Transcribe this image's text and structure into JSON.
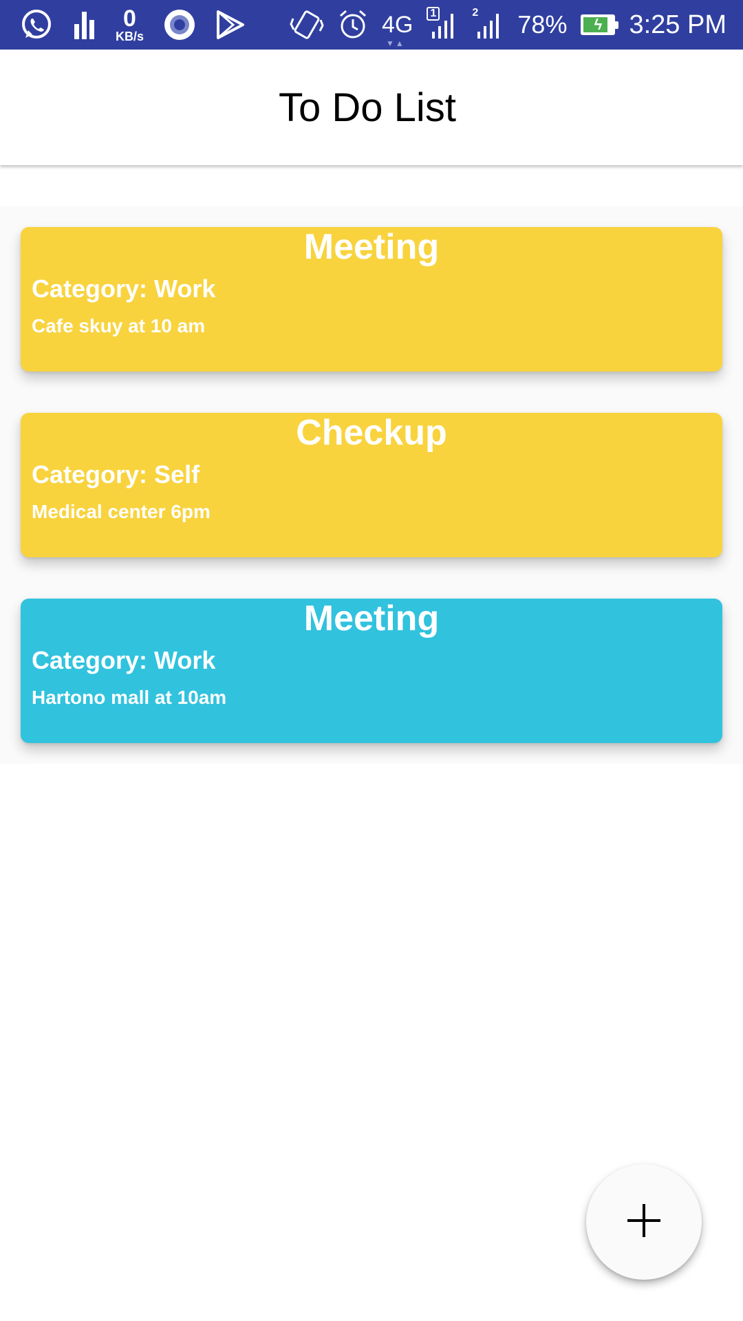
{
  "status_bar": {
    "icons_left": [
      "whatsapp-icon",
      "signal-bars-icon",
      "data-speed-icon",
      "circle-record-icon",
      "play-store-icon"
    ],
    "data_speed_value": "0",
    "data_speed_unit": "KB/s",
    "icons_right": [
      "vibrate-icon",
      "alarm-icon",
      "network-type-icon",
      "sim1-signal-icon",
      "sim2-signal-icon",
      "battery-icon"
    ],
    "network_type": "4G",
    "sim1_label": "1",
    "sim2_label": "2",
    "battery_percent": "78%",
    "battery_level": 0.78,
    "battery_color": "#4caf50",
    "time": "3:25 PM",
    "background_color": "#303f9f"
  },
  "app_bar": {
    "title": "To Do List"
  },
  "todos": [
    {
      "title": "Meeting",
      "category": "Category: Work",
      "description": "Cafe skuy at 10 am",
      "color": "#f8d33e"
    },
    {
      "title": "Checkup",
      "category": "Category: Self",
      "description": "Medical center 6pm",
      "color": "#f8d33e"
    },
    {
      "title": "Meeting",
      "category": "Category: Work",
      "description": "Hartono mall at 10am",
      "color": "#31c2de"
    }
  ],
  "fab": {
    "icon": "plus-icon"
  }
}
